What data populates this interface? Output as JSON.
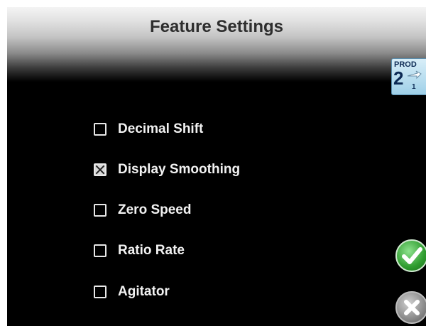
{
  "header": {
    "title": "Feature Settings"
  },
  "product_badge": {
    "label": "PROD",
    "number": "2",
    "sub": "1"
  },
  "options": [
    {
      "label": "Decimal Shift",
      "checked": false
    },
    {
      "label": "Display Smoothing",
      "checked": true
    },
    {
      "label": "Zero Speed",
      "checked": false
    },
    {
      "label": "Ratio Rate",
      "checked": false
    },
    {
      "label": "Agitator",
      "checked": false
    }
  ],
  "actions": {
    "accept_icon": "checkmark-icon",
    "cancel_icon": "x-icon"
  }
}
